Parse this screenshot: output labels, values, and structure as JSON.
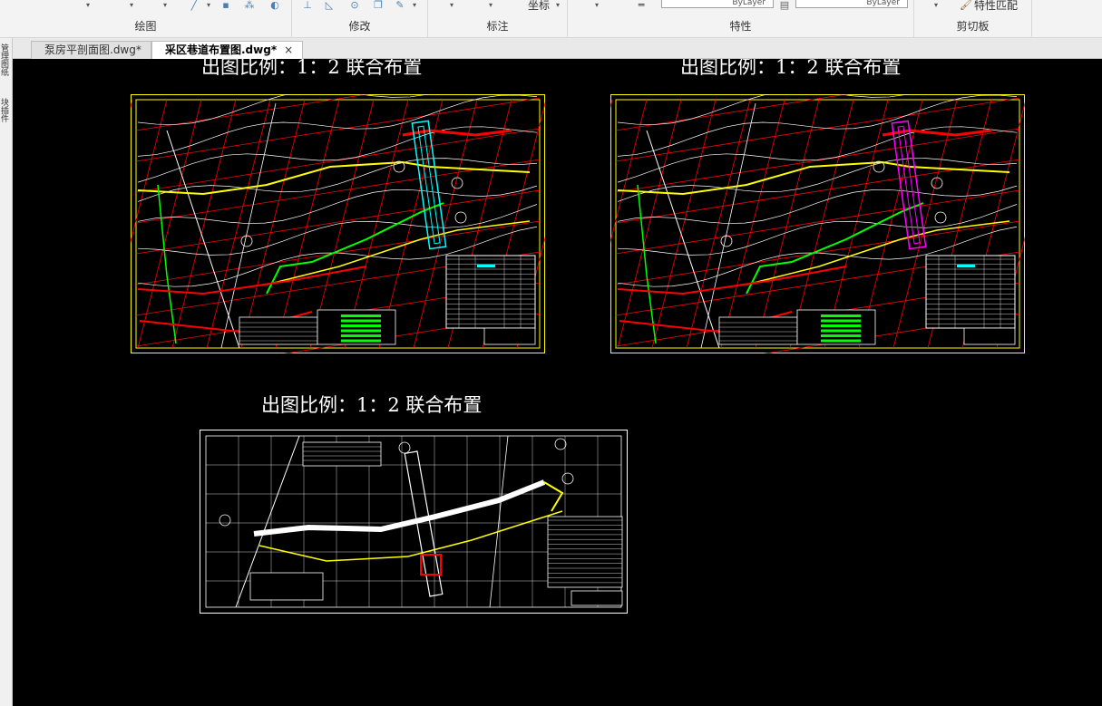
{
  "ribbon": {
    "panels": [
      {
        "id": "draw",
        "label": "绘图"
      },
      {
        "id": "modify",
        "label": "修改"
      },
      {
        "id": "annotate",
        "label": "标注"
      },
      {
        "id": "properties",
        "label": "特性"
      },
      {
        "id": "clipboard",
        "label": "剪切板"
      }
    ],
    "coordinate_label": "坐标",
    "bylayer_1": "ByLayer",
    "bylayer_2": "ByLayer",
    "match_properties_label": "特性匹配"
  },
  "tabs": [
    {
      "label": "泵房平剖面图.dwg*",
      "active": false
    },
    {
      "label": "采区巷道布置图.dwg*",
      "active": true
    }
  ],
  "tab_close_glyph": "×",
  "left_panel": {
    "labels": [
      "管理图纸",
      "块插件"
    ]
  },
  "canvas": {
    "background": "#000000",
    "layouts": [
      {
        "title": "出图比例：1：2  联合布置",
        "style": "color",
        "variant": "a"
      },
      {
        "title": "出图比例：1：2  联合布置",
        "style": "color",
        "variant": "b"
      },
      {
        "title": "出图比例：1：2  联合布置",
        "style": "mono",
        "variant": "c"
      }
    ]
  },
  "colors": {
    "frame_yellow": "#ffff00",
    "grid_red": "#ff0000",
    "lines_white": "#ffffff",
    "green": "#00ff00",
    "cyan": "#00ffff",
    "magenta": "#ff00ff"
  }
}
